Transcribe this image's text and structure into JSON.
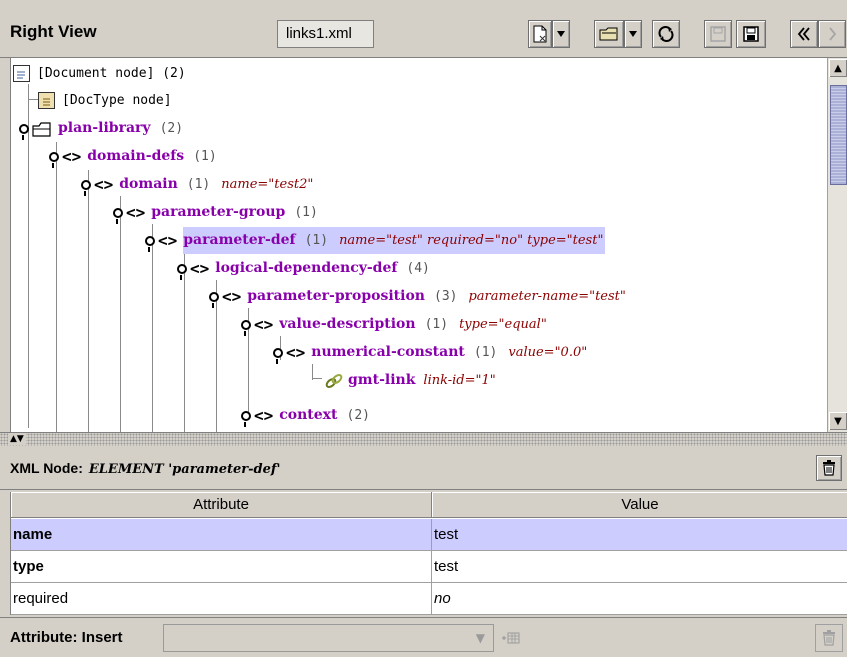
{
  "header": {
    "title": "Right View",
    "file_label": "links1.xml",
    "toolbar": [
      {
        "icon": "new-document-icon",
        "state": "enabled"
      },
      {
        "icon": "dropdown-arrow-icon",
        "state": "enabled"
      },
      {
        "icon": "open-folder-icon",
        "state": "enabled"
      },
      {
        "icon": "dropdown-arrow-icon",
        "state": "enabled"
      },
      {
        "icon": "refresh-icon",
        "state": "enabled"
      },
      {
        "icon": "save-icon",
        "state": "disabled"
      },
      {
        "icon": "save-as-icon",
        "state": "enabled"
      },
      {
        "icon": "back-icon",
        "state": "enabled"
      },
      {
        "icon": "forward-icon",
        "state": "disabled"
      }
    ]
  },
  "tree": {
    "rows": [
      {
        "kind": "document",
        "text": "[Document node] (2)"
      },
      {
        "kind": "doctype",
        "text": "[DocType node]"
      },
      {
        "kind": "root",
        "tag": "plan-library",
        "count": "(2)",
        "attrs": ""
      },
      {
        "kind": "element",
        "tag": "domain-defs",
        "count": "(1)",
        "attrs": ""
      },
      {
        "kind": "element",
        "tag": "domain",
        "count": "(1)",
        "attrs": "name=\"test2\""
      },
      {
        "kind": "element",
        "tag": "parameter-group",
        "count": "(1)",
        "attrs": ""
      },
      {
        "kind": "element",
        "tag": "parameter-def",
        "count": "(1)",
        "attrs": "name=\"test\" required=\"no\" type=\"test\"",
        "selected": true
      },
      {
        "kind": "element",
        "tag": "logical-dependency-def",
        "count": "(4)",
        "attrs": ""
      },
      {
        "kind": "element",
        "tag": "parameter-proposition",
        "count": "(3)",
        "attrs": "parameter-name=\"test\""
      },
      {
        "kind": "element",
        "tag": "value-description",
        "count": "(1)",
        "attrs": "type=\"equal\""
      },
      {
        "kind": "element",
        "tag": "numerical-constant",
        "count": "(1)",
        "attrs": "value=\"0.0\""
      },
      {
        "kind": "link",
        "tag": "gmt-link",
        "count": "",
        "attrs": "link-id=\"1\""
      },
      {
        "kind": "element",
        "tag": "context",
        "count": "(2)",
        "attrs": ""
      }
    ]
  },
  "node_bar": {
    "label": "XML Node:",
    "description": "ELEMENT 'parameter-def'"
  },
  "attributes_table": {
    "columns": [
      "Attribute",
      "Value"
    ],
    "rows": [
      {
        "name": "name",
        "value": "test",
        "style": "selected-bold"
      },
      {
        "name": "type",
        "value": "test",
        "style": "bold"
      },
      {
        "name": "required",
        "value": "no",
        "style": "italic-value"
      }
    ]
  },
  "bottom_bar": {
    "label": "Attribute: Insert",
    "combo_value": ""
  }
}
